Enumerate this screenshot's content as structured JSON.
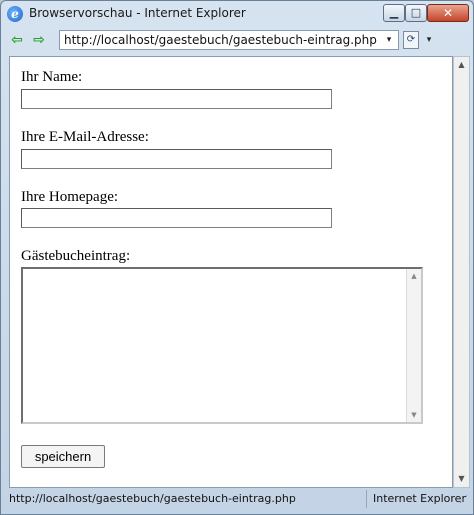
{
  "window": {
    "title": "Browservorschau - Internet Explorer",
    "browser_icon": "ie-logo-icon",
    "controls": {
      "minimize": "▁",
      "maximize": "□",
      "close": "✕"
    }
  },
  "navigation": {
    "back_icon": "green-back-arrow-icon",
    "forward_icon": "green-forward-arrow-icon",
    "address": "http://localhost/gaestebuch/gaestebuch-eintrag.php",
    "address_dropdown": "▾",
    "compat_icon": "page-compat-icon",
    "compat_dropdown": "▾"
  },
  "form": {
    "name_label": "Ihr Name:",
    "name_value": "",
    "email_label": "Ihre E-Mail-Adresse:",
    "email_value": "",
    "homepage_label": "Ihre Homepage:",
    "homepage_value": "",
    "entry_label": "Gästebucheintrag:",
    "entry_value": "",
    "submit_label": "speichern"
  },
  "statusbar": {
    "url": "http://localhost/gaestebuch/gaestebuch-eintrag.php",
    "zone": "Internet Explorer"
  },
  "colors": {
    "frame": "#c3d4e6",
    "close_button": "#c4442a",
    "nav_arrows": "#22a322"
  }
}
